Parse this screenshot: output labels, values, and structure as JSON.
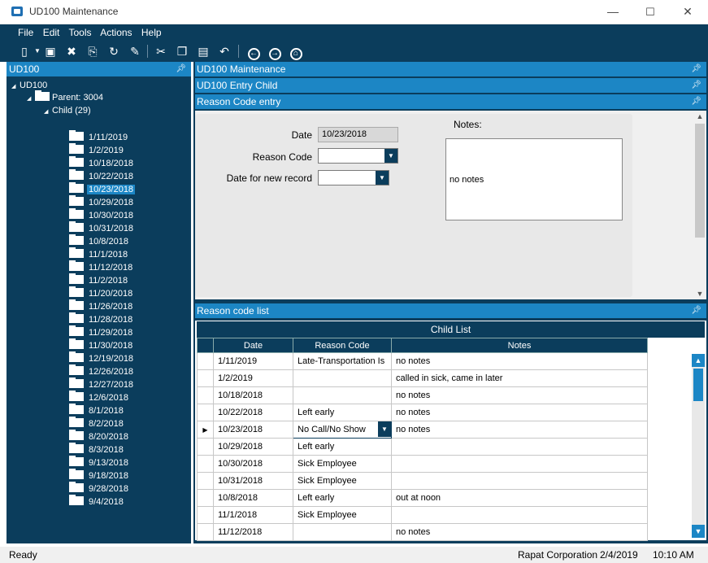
{
  "window": {
    "title": "UD100 Maintenance",
    "minimize": "—",
    "maximize": "☐",
    "close": "✕"
  },
  "menu": [
    "File",
    "Edit",
    "Tools",
    "Actions",
    "Help"
  ],
  "left_panel": {
    "header": "UD100",
    "root": "UD100",
    "parent": "Parent: 3004",
    "child": "Child (29)",
    "items": [
      "1/11/2019",
      "1/2/2019",
      "10/18/2018",
      "10/22/2018",
      "10/23/2018",
      "10/29/2018",
      "10/30/2018",
      "10/31/2018",
      "10/8/2018",
      "11/1/2018",
      "11/12/2018",
      "11/2/2018",
      "11/20/2018",
      "11/26/2018",
      "11/28/2018",
      "11/29/2018",
      "11/30/2018",
      "12/19/2018",
      "12/26/2018",
      "12/27/2018",
      "12/6/2018",
      "8/1/2018",
      "8/2/2018",
      "8/20/2018",
      "8/3/2018",
      "9/13/2018",
      "9/18/2018",
      "9/28/2018",
      "9/4/2018"
    ],
    "selected": "10/23/2018"
  },
  "panels": {
    "p1": "UD100 Maintenance",
    "p2": "UD100 Entry Child",
    "p3": "Reason Code entry",
    "p4": "Reason code list"
  },
  "form": {
    "date_label": "Date",
    "date_value": "10/23/2018",
    "reason_label": "Reason Code",
    "reason_value": "",
    "newdate_label": "Date for new record",
    "newdate_value": "",
    "notes_label": "Notes:",
    "notes_value": "no notes"
  },
  "grid": {
    "title": "Child List",
    "columns": [
      "Date",
      "Reason Code",
      "Notes"
    ],
    "rows": [
      {
        "date": "1/11/2019",
        "reason": "Late-Transportation Is",
        "notes": "no notes"
      },
      {
        "date": "1/2/2019",
        "reason": "",
        "notes": "called in sick, came in later"
      },
      {
        "date": "10/18/2018",
        "reason": "",
        "notes": "no notes"
      },
      {
        "date": "10/22/2018",
        "reason": "Left early",
        "notes": "no notes"
      },
      {
        "date": "10/23/2018",
        "reason": "No Call/No Show",
        "notes": "no notes"
      },
      {
        "date": "10/29/2018",
        "reason": "Left early",
        "notes": ""
      },
      {
        "date": "10/30/2018",
        "reason": "Sick Employee",
        "notes": ""
      },
      {
        "date": "10/31/2018",
        "reason": "Sick Employee",
        "notes": ""
      },
      {
        "date": "10/8/2018",
        "reason": "Left early",
        "notes": "out at noon"
      },
      {
        "date": "11/1/2018",
        "reason": "Sick Employee",
        "notes": ""
      },
      {
        "date": "11/12/2018",
        "reason": "",
        "notes": "no notes"
      }
    ],
    "current_row_index": 4
  },
  "status": {
    "left": "Ready",
    "company": "Rapat Corporation",
    "date": "2/4/2019",
    "time": "10:10 AM"
  },
  "icons": {
    "pin": "pin-icon",
    "dropdown": "chevron-down-icon",
    "row_pointer": "triangle-right-icon"
  }
}
